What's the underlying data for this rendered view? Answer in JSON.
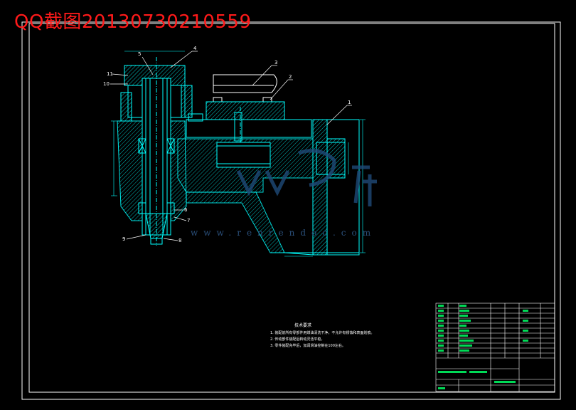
{
  "watermark": "QQ截图20130730210559",
  "part_labels": [
    "1",
    "2",
    "3",
    "4",
    "5",
    "6",
    "7",
    "8",
    "9",
    "10",
    "11"
  ],
  "tech_requirements": {
    "title": "技术要求",
    "notes": [
      "1. 装配前所有零部件用煤油清洗干净，不允许有锈蚀和表面划痕。",
      "2. 传动部件装配后转动灵活平稳。",
      "3. 零件装配完毕后，加润滑油控制在100左右。"
    ]
  },
  "logo": {
    "text": "人人文库",
    "url_text": "www.renrendoc.com"
  },
  "colors": {
    "background": "#000000",
    "frame": "#ffffff",
    "outline": "#00ffff",
    "hatch": "#00cccc",
    "label": "#00ff66",
    "watermark": "#ff1a1a"
  }
}
